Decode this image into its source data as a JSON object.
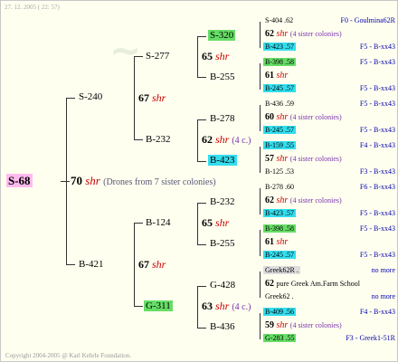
{
  "header": {
    "date": "27. 12. 2005 ( 22: 57)"
  },
  "footer": {
    "copyright": "Copyright 2004-2005 @ Karl Kehrle Foundation."
  },
  "root": {
    "id": "S-68",
    "num": "70",
    "shr": "shr",
    "note": "(Drones from 7 sister colonies)"
  },
  "g1": [
    {
      "id": "S-240",
      "num": "67",
      "shr": "shr"
    },
    {
      "id": "B-421",
      "num": "67",
      "shr": "shr"
    }
  ],
  "g2": [
    {
      "id": "S-277",
      "num": "65",
      "shr": "shr"
    },
    {
      "id": "B-232",
      "num": "62",
      "shr": "shr",
      "note": "(4 c.)"
    },
    {
      "id": "B-124",
      "num": "65",
      "shr": "shr"
    },
    {
      "id": "G-311",
      "num": "63",
      "shr": "shr",
      "note": "(4 c.)"
    }
  ],
  "g3": [
    {
      "id": "S-320"
    },
    {
      "id": "B-255"
    },
    {
      "id": "B-278"
    },
    {
      "id": "B-423"
    },
    {
      "id": "B-232"
    },
    {
      "id": "B-255"
    },
    {
      "id": "G-428"
    },
    {
      "id": "B-436"
    }
  ],
  "g4": [
    {
      "top": "S-404 .62",
      "right": "F0 - Goulmina62R",
      "num": "62",
      "shr": "shr",
      "note": "(4 sister colonies)",
      "bottom": "B-423 .57",
      "bright": "F5 - B-xx43"
    },
    {
      "top": "B-398 .58",
      "right": "F5 - B-xx43",
      "num": "61",
      "shr": "shr",
      "note": "",
      "bottom": "B-245 .57",
      "bright": "F5 - B-xx43"
    },
    {
      "top": "B-436 .59",
      "right": "F5 - B-xx43",
      "num": "60",
      "shr": "shr",
      "note": "(4 sister colonies)",
      "bottom": "B-245 .57",
      "bright": "F5 - B-xx43"
    },
    {
      "top": "B-159 .55",
      "right": "F4 - B-xx43",
      "num": "57",
      "shr": "shr",
      "note": "(4 sister colonies)",
      "bottom": "B-125 .53",
      "bright": "F3 - B-xx43"
    },
    {
      "top": "B-278 .60",
      "right": "F6 - B-xx43",
      "num": "62",
      "shr": "shr",
      "note": "(4 sister colonies)",
      "bottom": "B-423 .57",
      "bright": "F5 - B-xx43"
    },
    {
      "top": "B-398 .58",
      "right": "F5 - B-xx43",
      "num": "61",
      "shr": "shr",
      "note": "",
      "bottom": "B-245 .57",
      "bright": "F5 - B-xx43"
    },
    {
      "top": "Greek62R .",
      "right": "no more",
      "num": "62",
      "shr": "",
      "note": "pure Greek Am.Farm School",
      "bottom": "Greek62 .",
      "bright": "no more"
    },
    {
      "top": "B-409 .56",
      "right": "F4 - B-xx43",
      "num": "59",
      "shr": "shr",
      "note": "(4 sister colonies)",
      "bottom": "G-283 .55",
      "bright": "F3 - Greek1-51R"
    }
  ]
}
